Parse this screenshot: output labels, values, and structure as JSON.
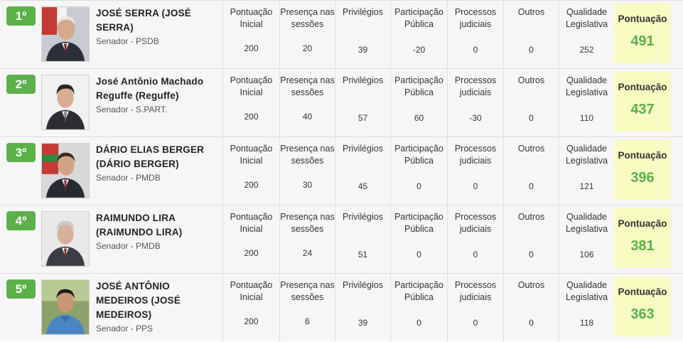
{
  "labels": {
    "pontuacao_inicial": "Pontuação Inicial",
    "presenca": "Presença nas sessões",
    "privilegios": "Privilégios",
    "participacao": "Participação Pública",
    "processos": "Processos judiciais",
    "outros": "Outros",
    "qualidade": "Qualidade Legislativa",
    "pontuacao": "Pontuação"
  },
  "rows": [
    {
      "rank": "1º",
      "name": "JOSÉ SERRA (JOSÉ SERRA)",
      "party": "Senador - PSDB",
      "inicial": "200",
      "presenca": "20",
      "privilegios": "39",
      "participacao": "-20",
      "processos": "0",
      "outros": "0",
      "qualidade": "252",
      "pontuacao": "491",
      "photo": "white-haired man with flag background"
    },
    {
      "rank": "2º",
      "name": "José Antônio Machado Reguffe (Reguffe)",
      "party": "Senador - S.PART.",
      "inicial": "200",
      "presenca": "40",
      "privilegios": "57",
      "participacao": "60",
      "processos": "-30",
      "outros": "0",
      "qualidade": "110",
      "pontuacao": "437",
      "photo": "dark-haired man in suit"
    },
    {
      "rank": "3º",
      "name": "DÁRIO ELIAS BERGER (DÁRIO BERGER)",
      "party": "Senador - PMDB",
      "inicial": "200",
      "presenca": "30",
      "privilegios": "45",
      "participacao": "0",
      "processos": "0",
      "outros": "0",
      "qualidade": "121",
      "pontuacao": "396",
      "photo": "man in suit with flag background"
    },
    {
      "rank": "4º",
      "name": "RAIMUNDO LIRA (RAIMUNDO LIRA)",
      "party": "Senador - PMDB",
      "inicial": "200",
      "presenca": "24",
      "privilegios": "51",
      "participacao": "0",
      "processos": "0",
      "outros": "0",
      "qualidade": "106",
      "pontuacao": "381",
      "photo": "gray-haired man in suit"
    },
    {
      "rank": "5º",
      "name": "JOSÉ ANTÔNIO MEDEIROS (JOSÉ MEDEIROS)",
      "party": "Senador - PPS",
      "inicial": "200",
      "presenca": "6",
      "privilegios": "39",
      "participacao": "0",
      "processos": "0",
      "outros": "0",
      "qualidade": "118",
      "pontuacao": "363",
      "photo": "man in blue shirt outdoors"
    }
  ]
}
